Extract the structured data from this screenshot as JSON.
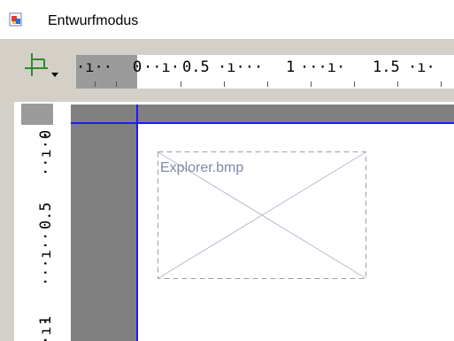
{
  "window": {
    "title": "Entwurfmodus",
    "icon": "app-document-icon"
  },
  "toolbar": {
    "snap_button_icon": "crop-anchor-icon",
    "dropdown_icon": "chevron-down-icon"
  },
  "ruler_horizontal": {
    "labels": [
      "0",
      "0.5",
      "1",
      "1.5"
    ]
  },
  "ruler_vertical": {
    "labels": [
      "0",
      "0.5",
      "1"
    ]
  },
  "canvas": {
    "image_placeholder_label": "Explorer.bmp",
    "guide_color": "#1a1aff",
    "margin_color": "#808080"
  }
}
